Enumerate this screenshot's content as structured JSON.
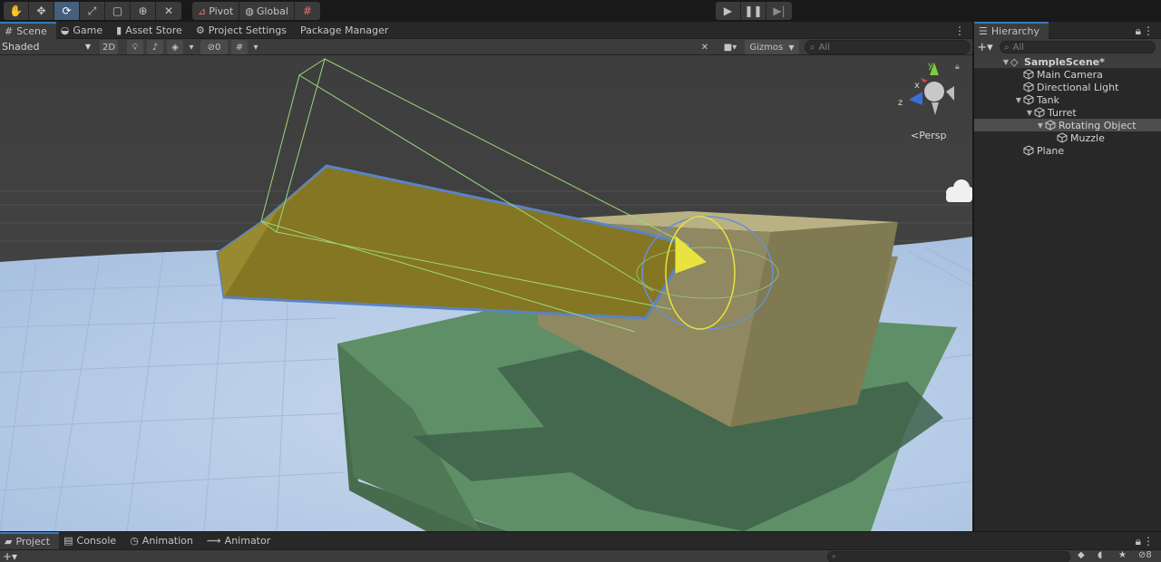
{
  "toolbar": {
    "tools": [
      "hand-tool",
      "move-tool",
      "rotate-tool",
      "scale-tool",
      "rect-tool",
      "transform-tool",
      "custom-editor-tool"
    ],
    "active_tool": "rotate-tool",
    "pivot_label": "Pivot",
    "global_label": "Global",
    "grid_snap_icon": "grid-snap-icon",
    "play_controls": [
      "play-icon",
      "pause-icon",
      "step-icon"
    ]
  },
  "scene_panel": {
    "tabs": [
      {
        "label": "Scene",
        "icon": "grid-icon",
        "active": true
      },
      {
        "label": "Game",
        "icon": "gamepad-icon"
      },
      {
        "label": "Asset Store",
        "icon": "bag-icon"
      },
      {
        "label": "Project Settings",
        "icon": "gear-icon"
      },
      {
        "label": "Package Manager",
        "icon": ""
      }
    ],
    "shading_mode": "Shaded",
    "mode_2d": "2D",
    "hidden_count": "0",
    "gizmos_label": "Gizmos",
    "search_placeholder": "All",
    "projection_label": "Persp",
    "axis_labels": {
      "y": "y",
      "x": "x",
      "z": "z"
    }
  },
  "hierarchy": {
    "tab_label": "Hierarchy",
    "search_placeholder": "All",
    "items": [
      {
        "label": "SampleScene*",
        "depth": 0,
        "expanded": true,
        "type": "scene"
      },
      {
        "label": "Main Camera",
        "depth": 1,
        "type": "object"
      },
      {
        "label": "Directional Light",
        "depth": 1,
        "type": "object"
      },
      {
        "label": "Tank",
        "depth": 1,
        "expanded": true,
        "type": "object"
      },
      {
        "label": "Turret",
        "depth": 2,
        "expanded": true,
        "type": "object"
      },
      {
        "label": "Rotating Object",
        "depth": 3,
        "expanded": true,
        "type": "object",
        "selected": true
      },
      {
        "label": "Muzzle",
        "depth": 4,
        "type": "object"
      },
      {
        "label": "Plane",
        "depth": 1,
        "type": "object"
      }
    ]
  },
  "bottom_panel": {
    "tabs": [
      {
        "label": "Project",
        "icon": "folder-icon",
        "active": true
      },
      {
        "label": "Console",
        "icon": "console-icon"
      },
      {
        "label": "Animation",
        "icon": "clock-icon"
      },
      {
        "label": "Animator",
        "icon": "animator-icon"
      }
    ],
    "hidden_count": "8"
  },
  "colors": {
    "accent": "#3a79bb",
    "selection": "#46607c",
    "ground": "#b8cde8",
    "tank_body": "#5a8a62",
    "turret": "#8c8459",
    "barrel": "#857623"
  }
}
